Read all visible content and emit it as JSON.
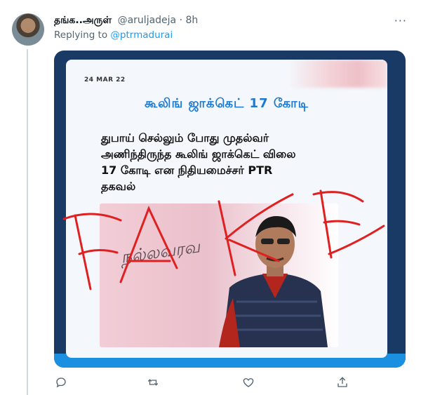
{
  "tweet": {
    "author_name": "தங்க..அருள்",
    "handle": "@aruljadeja",
    "separator": "·",
    "time": "8h",
    "reply_prefix": "Replying to",
    "reply_handle": "@ptrmadurai"
  },
  "media": {
    "date": "24 MAR 22",
    "headline": "கூலிங் ஜாக்கெட் 17 கோடி",
    "description_lines": [
      "துபாய் செல்லும் போது முதல்வர்",
      "அணிந்திருந்த கூலிங் ஜாக்கெட் விலை",
      "17 கோடி என நிதியமைச்சர் PTR",
      "தகவல்"
    ],
    "photo_script_text": "நல்லவரவ",
    "overlay_text": "FAKE",
    "colors": {
      "overlay": "#e02020",
      "headline": "#1c7ad3",
      "frame": "#1a3a66",
      "band": "#1b8fe0"
    }
  },
  "icons": {
    "more": "more-icon",
    "reply": "reply-icon",
    "retweet": "retweet-icon",
    "like": "heart-icon",
    "share": "share-icon"
  }
}
